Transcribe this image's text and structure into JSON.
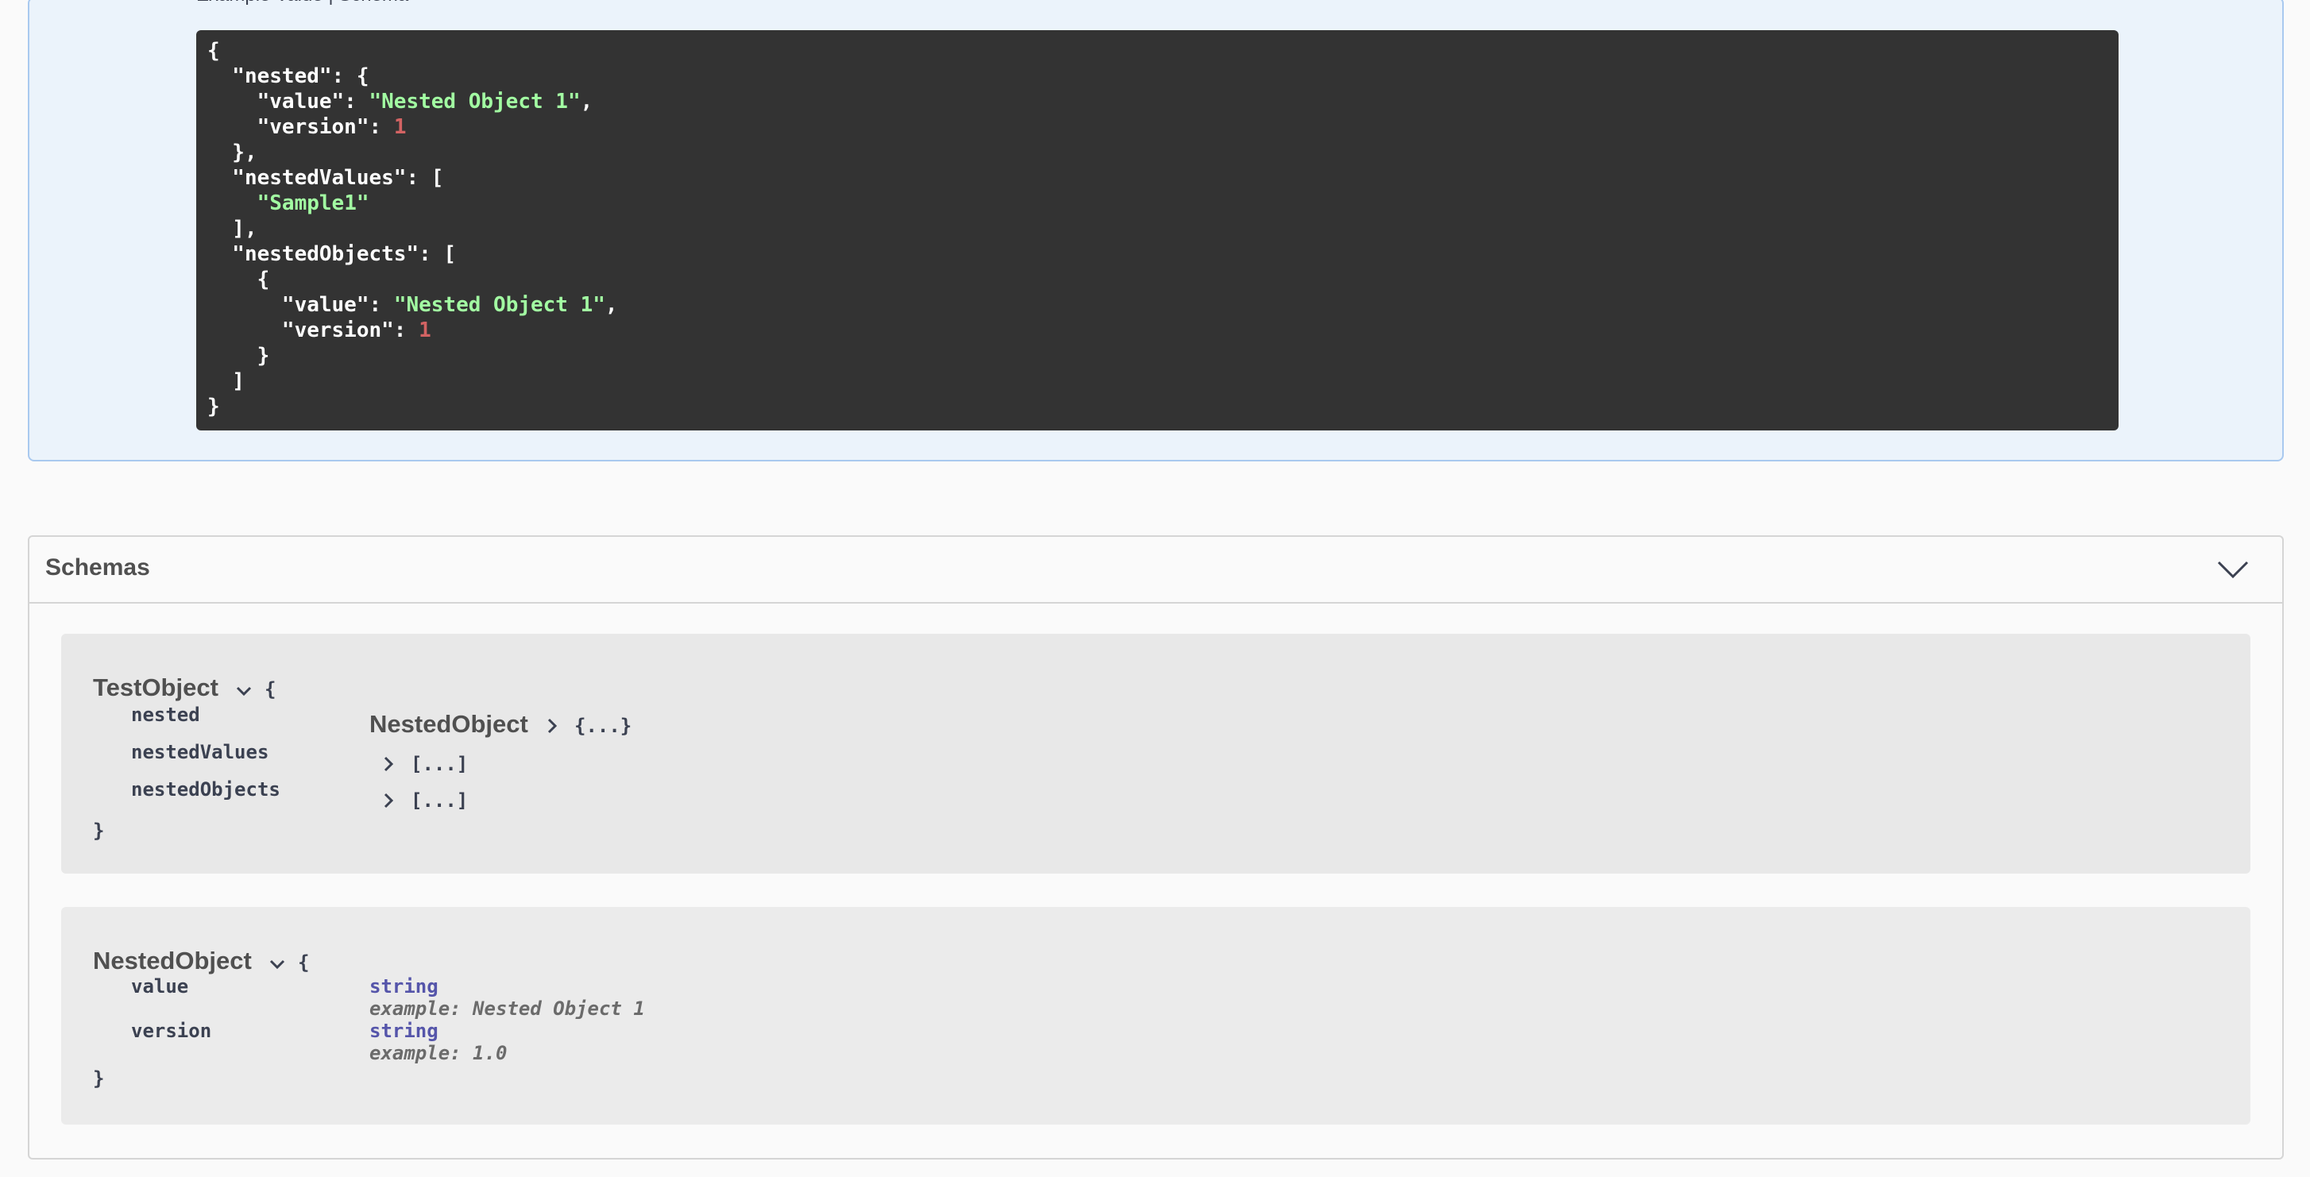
{
  "response": {
    "partial_label": "Example Value | Schema",
    "code_lines": [
      [
        {
          "t": "{",
          "c": ""
        }
      ],
      [
        {
          "t": "  \"nested\": {",
          "c": ""
        }
      ],
      [
        {
          "t": "    \"value\": ",
          "c": ""
        },
        {
          "t": "\"Nested Object 1\"",
          "c": "s"
        },
        {
          "t": ",",
          "c": ""
        }
      ],
      [
        {
          "t": "    \"version\": ",
          "c": ""
        },
        {
          "t": "1",
          "c": "n"
        }
      ],
      [
        {
          "t": "  },",
          "c": ""
        }
      ],
      [
        {
          "t": "  \"nestedValues\": [",
          "c": ""
        }
      ],
      [
        {
          "t": "    ",
          "c": ""
        },
        {
          "t": "\"Sample1\"",
          "c": "s"
        }
      ],
      [
        {
          "t": "  ],",
          "c": ""
        }
      ],
      [
        {
          "t": "  \"nestedObjects\": [",
          "c": ""
        }
      ],
      [
        {
          "t": "    {",
          "c": ""
        }
      ],
      [
        {
          "t": "      \"value\": ",
          "c": ""
        },
        {
          "t": "\"Nested Object 1\"",
          "c": "s"
        },
        {
          "t": ",",
          "c": ""
        }
      ],
      [
        {
          "t": "      \"version\": ",
          "c": ""
        },
        {
          "t": "1",
          "c": "n"
        }
      ],
      [
        {
          "t": "    }",
          "c": ""
        }
      ],
      [
        {
          "t": "  ]",
          "c": ""
        }
      ],
      [
        {
          "t": "}",
          "c": ""
        }
      ]
    ]
  },
  "schemas": {
    "title": "Schemas",
    "expanded": true,
    "models": {
      "test_object": {
        "name": "TestObject",
        "open_brace": "{",
        "close_brace": "}",
        "properties": [
          {
            "name": "nested",
            "ref": "NestedObject",
            "collapsed": "{...}"
          },
          {
            "name": "nestedValues",
            "collapsed": "[...]"
          },
          {
            "name": "nestedObjects",
            "collapsed": "[...]"
          }
        ]
      },
      "nested_object": {
        "name": "NestedObject",
        "open_brace": "{",
        "close_brace": "}",
        "properties": [
          {
            "name": "value",
            "type": "string",
            "example": "example: Nested Object 1"
          },
          {
            "name": "version",
            "type": "string",
            "example": "example: 1.0"
          }
        ]
      }
    }
  },
  "colors": {
    "code_bg": "#333333",
    "code_string": "#a2fca2",
    "code_number": "#d36363",
    "panel_bg": "#ebf3fb",
    "panel_border": "#a9c9ef",
    "type_color": "#5555aa"
  },
  "icons": {
    "schemas_toggle": "chevron-down-icon",
    "model_expand": "chevron-down-icon",
    "ref_collapse": "chevron-right-icon"
  }
}
